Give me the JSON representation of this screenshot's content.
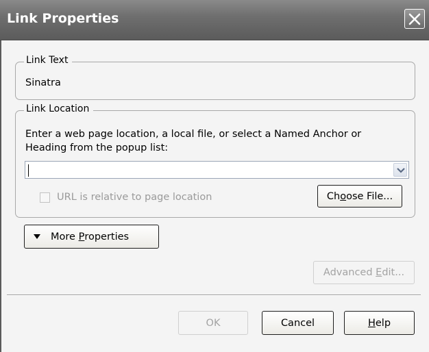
{
  "window": {
    "title": "Link Properties",
    "close_icon": "close-icon"
  },
  "link_text_group": {
    "legend": "Link Text",
    "value": "Sinatra"
  },
  "link_location_group": {
    "legend": "Link Location",
    "instructions_line1": "Enter a web page location, a local file, or select a Named Anchor or",
    "instructions_line2": "Heading from the popup list:",
    "url_value": "",
    "relative_checkbox_label": "URL is relative to page location",
    "relative_checked": false,
    "choose_file_pre": "Ch",
    "choose_file_accel": "o",
    "choose_file_post": "ose File..."
  },
  "more_properties": {
    "pre": "More ",
    "accel": "P",
    "post": "roperties",
    "icon": "triangle-down-icon"
  },
  "advanced_edit": {
    "pre": "Advanced ",
    "accel": "E",
    "post": "dit..."
  },
  "footer": {
    "ok_label": "OK",
    "cancel_label": "Cancel",
    "help_accel": "H",
    "help_post": "elp"
  },
  "colors": {
    "titlebar": "#6f6f6f",
    "dialog_bg": "#f4f4f4",
    "disabled_text": "#9a9a9a"
  }
}
